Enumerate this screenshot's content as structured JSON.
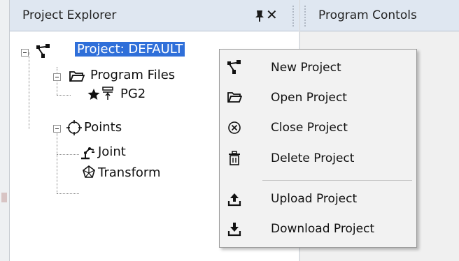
{
  "project_explorer": {
    "title": "Project Explorer",
    "pin_label": "📌",
    "close_label": "✕"
  },
  "program_controls": {
    "title": "Program Contols"
  },
  "tree": {
    "project": {
      "label": "Project: DEFAULT",
      "icon": "project-tree-icon",
      "selected": true
    },
    "program_files": {
      "label": "Program Files",
      "icon": "folder-icon"
    },
    "pg2": {
      "label": "PG2",
      "icon": "robot-program-icon"
    },
    "points": {
      "label": "Points",
      "icon": "crosshair-icon"
    },
    "joint": {
      "label": "Joint",
      "icon": "joint-icon"
    },
    "transform": {
      "label": "Transform",
      "icon": "transform-icon"
    }
  },
  "context_menu": {
    "items": [
      {
        "label": "New Project",
        "icon": "project-tree-icon"
      },
      {
        "label": "Open Project",
        "icon": "folder-open-icon"
      },
      {
        "label": "Close Project",
        "icon": "close-circle-icon"
      },
      {
        "label": "Delete Project",
        "icon": "trash-icon"
      },
      {
        "label": "Upload Project",
        "icon": "upload-icon"
      },
      {
        "label": "Download Project",
        "icon": "download-icon"
      }
    ]
  },
  "colors": {
    "selection": "#2f6fd9",
    "header_bg": "#dfe7f1",
    "menu_bg": "#f2f2f2"
  }
}
